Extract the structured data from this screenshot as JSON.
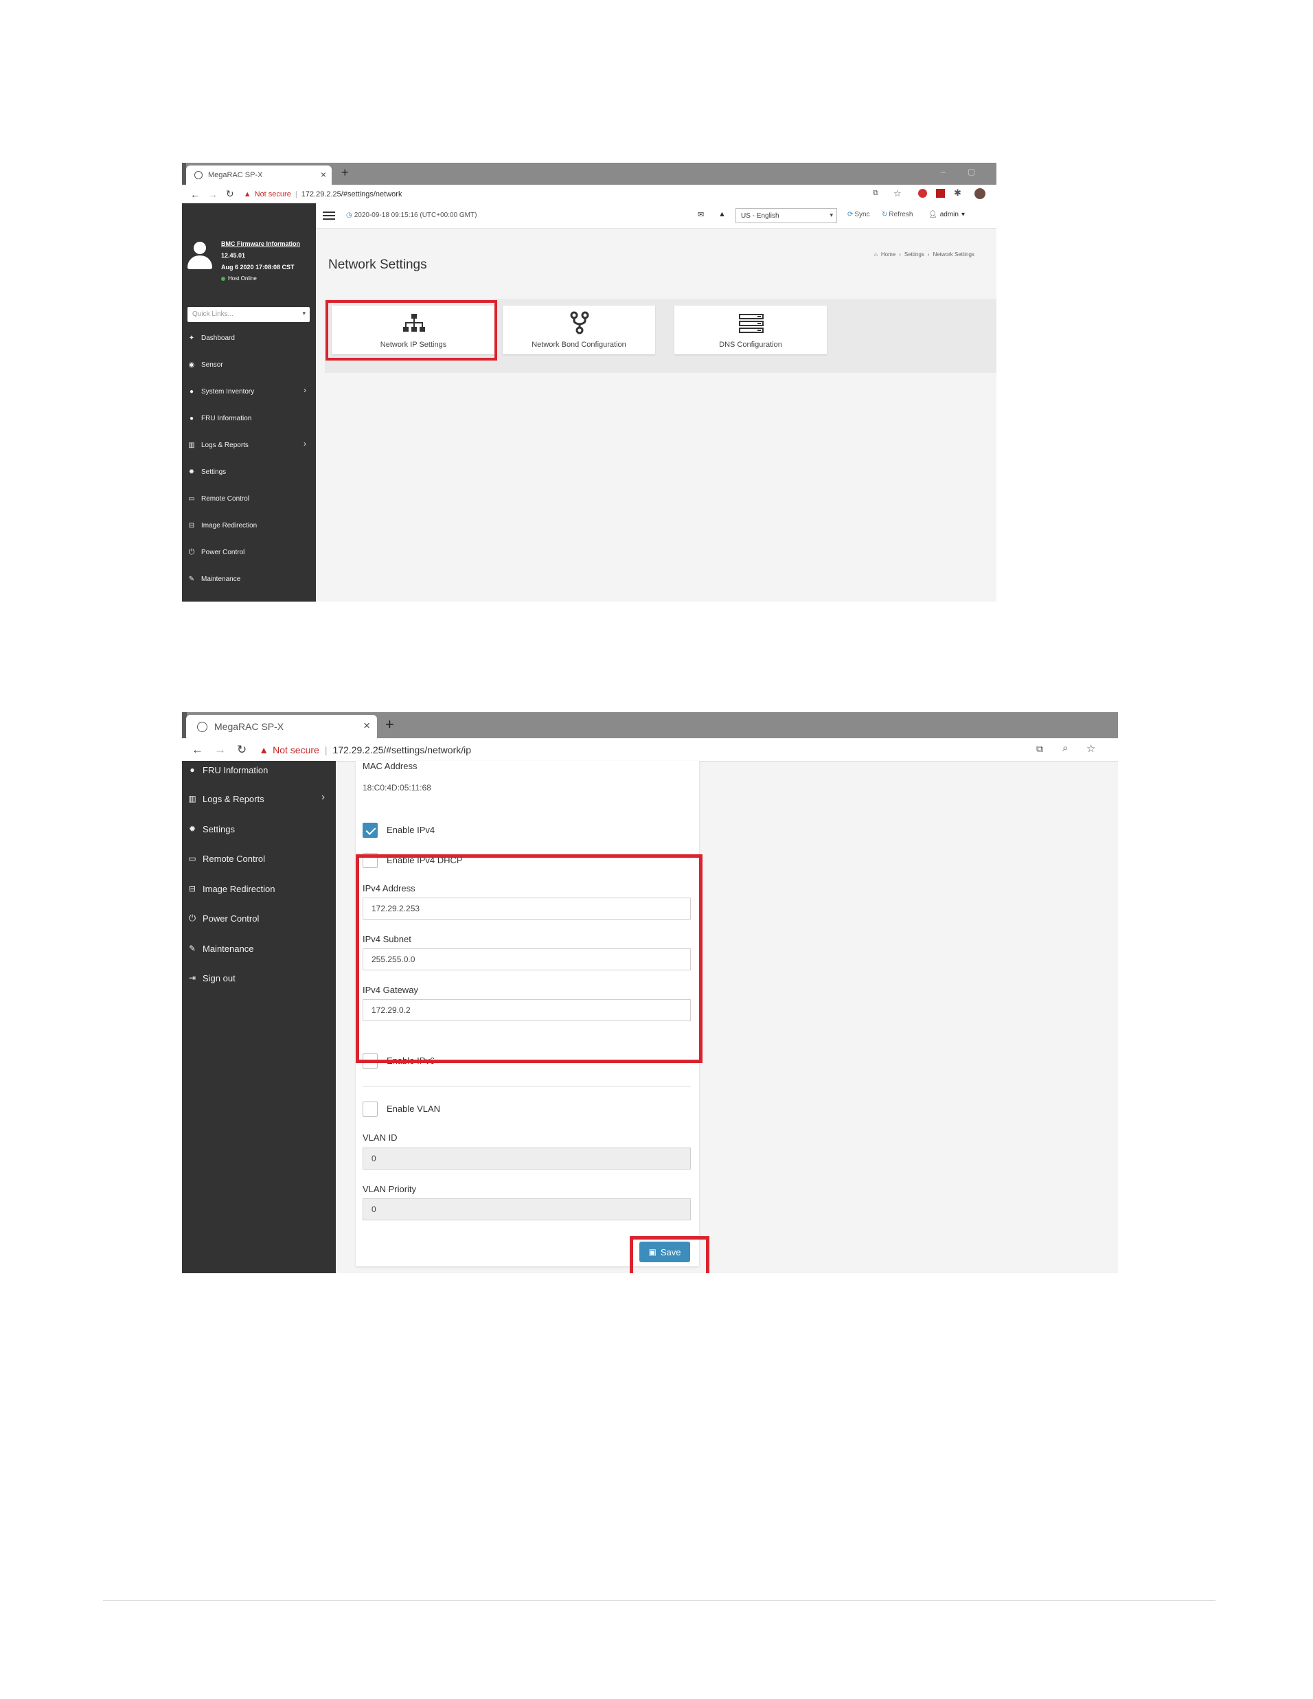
{
  "screenshot1": {
    "browser": {
      "tab_title": "MegaRAC SP-X",
      "tab_close": "×",
      "new_tab": "+",
      "not_secure": "Not secure",
      "url": "172.29.2.25/#settings/network"
    },
    "sidebar": {
      "firmware_title": "BMC Firmware Information",
      "firmware_version": "12.45.01",
      "firmware_date": "Aug 6 2020 17:08:08 CST",
      "host_status": "Host Online",
      "quick_links_placeholder": "Quick Links...",
      "items": [
        {
          "label": "Dashboard",
          "icon": "dashboard-icon"
        },
        {
          "label": "Sensor",
          "icon": "sensor-icon"
        },
        {
          "label": "System Inventory",
          "icon": "info-icon"
        },
        {
          "label": "FRU Information",
          "icon": "info-icon"
        },
        {
          "label": "Logs & Reports",
          "icon": "chart-icon"
        },
        {
          "label": "Settings",
          "icon": "gear-icon"
        },
        {
          "label": "Remote Control",
          "icon": "monitor-icon"
        },
        {
          "label": "Image Redirection",
          "icon": "drive-icon"
        },
        {
          "label": "Power Control",
          "icon": "power-icon"
        },
        {
          "label": "Maintenance",
          "icon": "wrench-icon"
        }
      ]
    },
    "topbar": {
      "datetime": "2020-09-18 09:15:16 (UTC+00:00 GMT)",
      "language": "US - English",
      "sync": "Sync",
      "refresh": "Refresh",
      "user": "admin"
    },
    "page_title": "Network Settings",
    "breadcrumb": {
      "home": "Home",
      "settings": "Settings",
      "current": "Network Settings"
    },
    "cards": [
      {
        "label": "Network IP Settings",
        "icon": "network-tree-icon"
      },
      {
        "label": "Network Bond Configuration",
        "icon": "fork-icon"
      },
      {
        "label": "DNS Configuration",
        "icon": "server-stack-icon"
      }
    ]
  },
  "screenshot2": {
    "browser": {
      "tab_title": "MegaRAC SP-X",
      "tab_close": "×",
      "new_tab": "+",
      "not_secure": "Not secure",
      "url": "172.29.2.25/#settings/network/ip"
    },
    "sidebar": {
      "items": [
        {
          "label": "FRU Information",
          "icon": "info-icon"
        },
        {
          "label": "Logs & Reports",
          "icon": "chart-icon"
        },
        {
          "label": "Settings",
          "icon": "gear-icon"
        },
        {
          "label": "Remote Control",
          "icon": "monitor-icon"
        },
        {
          "label": "Image Redirection",
          "icon": "drive-icon"
        },
        {
          "label": "Power Control",
          "icon": "power-icon"
        },
        {
          "label": "Maintenance",
          "icon": "wrench-icon"
        },
        {
          "label": "Sign out",
          "icon": "sign-out-icon"
        }
      ]
    },
    "form": {
      "mac_label": "MAC Address",
      "mac_value": "18:C0:4D:05:11:68",
      "enable_ipv4": {
        "label": "Enable IPv4",
        "checked": true
      },
      "enable_ipv4_dhcp": {
        "label": "Enable IPv4 DHCP",
        "checked": false
      },
      "ipv4_address": {
        "label": "IPv4 Address",
        "value": "172.29.2.253"
      },
      "ipv4_subnet": {
        "label": "IPv4 Subnet",
        "value": "255.255.0.0"
      },
      "ipv4_gateway": {
        "label": "IPv4 Gateway",
        "value": "172.29.0.2"
      },
      "enable_ipv6": {
        "label": "Enable IPv6",
        "checked": false
      },
      "enable_vlan": {
        "label": "Enable VLAN",
        "checked": false
      },
      "vlan_id": {
        "label": "VLAN ID",
        "value": "0"
      },
      "vlan_priority": {
        "label": "VLAN Priority",
        "value": "0"
      },
      "save_label": "Save"
    }
  },
  "colors": {
    "highlight": "#d9232e",
    "sidebar_bg": "#333333",
    "primary": "#3c8dbc",
    "online": "#4caf50"
  }
}
